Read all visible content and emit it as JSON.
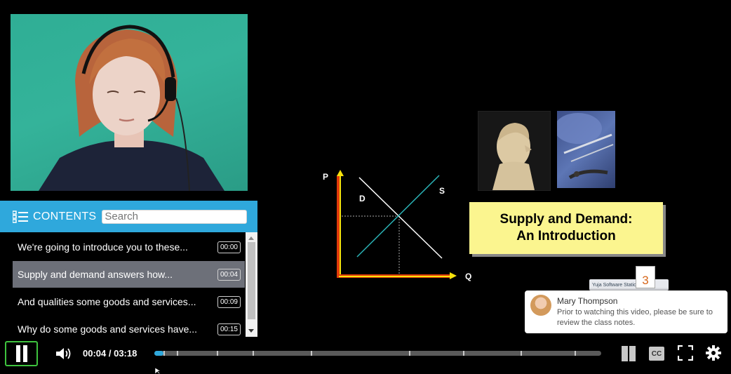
{
  "contents": {
    "title": "CONTENTS",
    "search_placeholder": "Search",
    "chapters": [
      {
        "title": "We're going to introduce you to these...",
        "time": "00:00",
        "active": false
      },
      {
        "title": "Supply and demand answers how...",
        "time": "00:04",
        "active": true
      },
      {
        "title": "And qualities some goods and services...",
        "time": "00:09",
        "active": false
      },
      {
        "title": "Why do some goods and services have...",
        "time": "00:15",
        "active": false
      }
    ]
  },
  "slide": {
    "title_line1": "Supply and Demand:",
    "title_line2": "An Introduction",
    "chart_labels": {
      "price": "P",
      "quantity": "Q",
      "demand": "D",
      "supply": "S"
    },
    "brand_badge": "3",
    "brand_tooltip": "Yuja Software Station"
  },
  "notification": {
    "sender": "Mary Thompson",
    "message": "Prior to watching this video, please be sure to review the class notes."
  },
  "player": {
    "timecode": "00:04 / 03:18",
    "progress_fraction": 0.02,
    "captions_label": "CC",
    "accent": "#2fa8dc",
    "play_outline": "#3ec33e",
    "chapter_marker_fractions": [
      0.02,
      0.05,
      0.14,
      0.22,
      0.35,
      0.57,
      0.69,
      0.82,
      0.94
    ],
    "icons": [
      "pause-icon",
      "volume-icon",
      "layout-icon",
      "closed-captions-icon",
      "fullscreen-icon",
      "settings-gear-icon"
    ]
  }
}
